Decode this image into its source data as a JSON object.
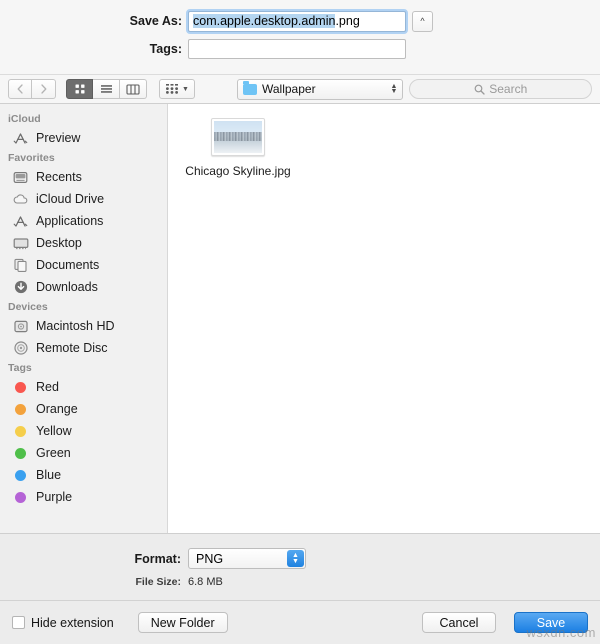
{
  "save_as": {
    "label": "Save As:",
    "value_selected": "com.apple.desktop.admin",
    "value_rest": ".png",
    "full_value": "com.apple.desktop.admin.png",
    "expand_icon": "chevron-up-icon"
  },
  "tags_field": {
    "label": "Tags:",
    "value": "",
    "placeholder": ""
  },
  "toolbar": {
    "back_icon": "chevron-left-icon",
    "forward_icon": "chevron-right-icon",
    "views": [
      {
        "name": "icon-view",
        "icon": "grid-icon",
        "active": true
      },
      {
        "name": "list-view",
        "icon": "list-icon",
        "active": false
      },
      {
        "name": "column-view",
        "icon": "columns-icon",
        "active": false
      }
    ],
    "arrange_icon": "arrange-grid-icon",
    "arrange_chevron": "chevron-down-icon",
    "location": {
      "icon": "folder-icon",
      "label": "Wallpaper",
      "stepper_icon": "up-down-chevron-icon"
    },
    "search": {
      "icon": "search-icon",
      "placeholder": "Search",
      "value": ""
    }
  },
  "sidebar": {
    "sections": [
      {
        "title": "iCloud",
        "items": [
          {
            "label": "Preview",
            "icon": "applications-a-icon"
          }
        ]
      },
      {
        "title": "Favorites",
        "items": [
          {
            "label": "Recents",
            "icon": "recents-clock-icon"
          },
          {
            "label": "iCloud Drive",
            "icon": "cloud-icon"
          },
          {
            "label": "Applications",
            "icon": "applications-a-icon"
          },
          {
            "label": "Desktop",
            "icon": "desktop-icon"
          },
          {
            "label": "Documents",
            "icon": "documents-icon"
          },
          {
            "label": "Downloads",
            "icon": "downloads-arrow-icon"
          }
        ]
      },
      {
        "title": "Devices",
        "items": [
          {
            "label": "Macintosh HD",
            "icon": "harddisk-icon"
          },
          {
            "label": "Remote Disc",
            "icon": "disc-icon"
          }
        ]
      },
      {
        "title": "Tags",
        "items": [
          {
            "label": "Red",
            "icon": "tag-dot-icon",
            "color": "#f9574f"
          },
          {
            "label": "Orange",
            "icon": "tag-dot-icon",
            "color": "#f3a23c"
          },
          {
            "label": "Yellow",
            "icon": "tag-dot-icon",
            "color": "#f5ce4b"
          },
          {
            "label": "Green",
            "icon": "tag-dot-icon",
            "color": "#4fbf4a"
          },
          {
            "label": "Blue",
            "icon": "tag-dot-icon",
            "color": "#3aa0ef"
          },
          {
            "label": "Purple",
            "icon": "tag-dot-icon",
            "color": "#b563d6"
          }
        ]
      }
    ]
  },
  "files": [
    {
      "name": "Chicago Skyline.jpg",
      "icon": "image-thumbnail"
    }
  ],
  "format_panel": {
    "format_label": "Format:",
    "format_value": "PNG",
    "format_stepper_icon": "up-down-chevron-icon",
    "filesize_label": "File Size:",
    "filesize_value": "6.8 MB"
  },
  "footer": {
    "hide_extension_label": "Hide extension",
    "hide_extension_checked": false,
    "new_folder_label": "New Folder",
    "cancel_label": "Cancel",
    "save_label": "Save"
  },
  "watermark": "wsxdn.com",
  "colors": {
    "accent": "#1b7fe3",
    "selection": "#b4d5f0",
    "sidebar_bg": "#f1f1f1",
    "panel_bg": "#ececec"
  }
}
